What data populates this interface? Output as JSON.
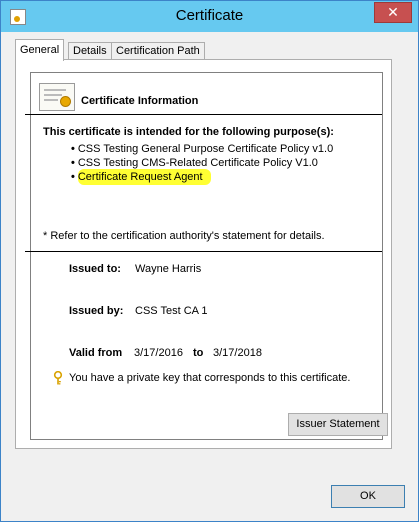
{
  "window": {
    "title": "Certificate",
    "close_glyph": "✕"
  },
  "tabs": [
    {
      "label": "General"
    },
    {
      "label": "Details"
    },
    {
      "label": "Certification Path"
    }
  ],
  "header": {
    "title": "Certificate Information"
  },
  "purpose": {
    "heading": "This certificate is intended for the following purpose(s):",
    "items": [
      "CSS Testing General Purpose Certificate Policy v1.0",
      "CSS Testing CMS-Related Certificate Policy V1.0",
      "Certificate Request Agent"
    ],
    "bullet": "•",
    "note": "* Refer to the certification authority's statement for details.",
    "highlight_color": "#ffff33"
  },
  "fields": {
    "issued_to_label": "Issued to:",
    "issued_to_value": "Wayne Harris",
    "issued_by_label": "Issued by:",
    "issued_by_value": "CSS Test CA 1",
    "valid_from_label": "Valid from",
    "valid_from_value": "3/17/2016",
    "valid_to_label": "to",
    "valid_to_value": "3/17/2018"
  },
  "private_key": {
    "text": "You have a private key that corresponds to this certificate.",
    "icon": "key-icon"
  },
  "buttons": {
    "issuer_statement": "Issuer Statement",
    "ok": "OK"
  },
  "colors": {
    "titlebar": "#66c9f0",
    "close": "#c75050",
    "highlight": "#ffff33"
  }
}
